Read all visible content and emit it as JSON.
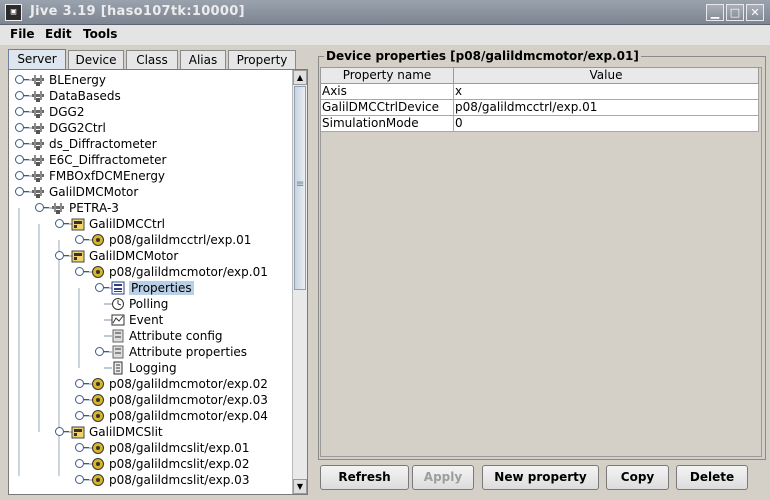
{
  "window": {
    "title": "Jive 3.19  [haso107tk:10000]",
    "app_icon_text": "▣",
    "min_glyph": "▁",
    "max_glyph": "□",
    "close_glyph": "✕"
  },
  "menu": {
    "file": "File",
    "edit": "Edit",
    "tools": "Tools"
  },
  "tabs": [
    {
      "label": "Server",
      "active": true
    },
    {
      "label": "Device",
      "active": false
    },
    {
      "label": "Class",
      "active": false
    },
    {
      "label": "Alias",
      "active": false
    },
    {
      "label": "Property",
      "active": false
    }
  ],
  "tree": [
    {
      "label": "BLEnergy",
      "icon": "server-icon"
    },
    {
      "label": "DataBaseds",
      "icon": "server-icon"
    },
    {
      "label": "DGG2",
      "icon": "server-icon"
    },
    {
      "label": "DGG2Ctrl",
      "icon": "server-icon"
    },
    {
      "label": "ds_Diffractometer",
      "icon": "server-icon"
    },
    {
      "label": "E6C_Diffractometer",
      "icon": "server-icon"
    },
    {
      "label": "FMBOxfDCMEnergy",
      "icon": "server-icon"
    },
    {
      "label": "GalilDMCMotor",
      "icon": "server-icon"
    },
    {
      "label": "PETRA-3",
      "icon": "server-icon"
    },
    {
      "label": "GalilDMCCtrl",
      "icon": "class-icon"
    },
    {
      "label": "p08/galildmcctrl/exp.01",
      "icon": "device-icon"
    },
    {
      "label": "GalilDMCMotor",
      "icon": "class-icon"
    },
    {
      "label": "p08/galildmcmotor/exp.01",
      "icon": "device-icon"
    },
    {
      "label": "Properties",
      "icon": "properties-icon",
      "selected": true
    },
    {
      "label": "Polling",
      "icon": "polling-icon"
    },
    {
      "label": "Event",
      "icon": "event-icon"
    },
    {
      "label": "Attribute config",
      "icon": "attribute-config-icon"
    },
    {
      "label": "Attribute properties",
      "icon": "attribute-properties-icon"
    },
    {
      "label": "Logging",
      "icon": "logging-icon"
    },
    {
      "label": "p08/galildmcmotor/exp.02",
      "icon": "device-icon"
    },
    {
      "label": "p08/galildmcmotor/exp.03",
      "icon": "device-icon"
    },
    {
      "label": "p08/galildmcmotor/exp.04",
      "icon": "device-icon"
    },
    {
      "label": "GalilDMCSlit",
      "icon": "class-icon"
    },
    {
      "label": "p08/galildmcslit/exp.01",
      "icon": "device-icon"
    },
    {
      "label": "p08/galildmcslit/exp.02",
      "icon": "device-icon"
    },
    {
      "label": "p08/galildmcslit/exp.03",
      "icon": "device-icon"
    }
  ],
  "panel": {
    "title": "Device properties [p08/galildmcmotor/exp.01]",
    "columns": [
      "Property name",
      "Value"
    ],
    "rows": [
      {
        "name": "Axis",
        "value": "x"
      },
      {
        "name": "GalilDMCCtrlDevice",
        "value": "p08/galildmcctrl/exp.01"
      },
      {
        "name": "SimulationMode",
        "value": "0"
      }
    ]
  },
  "buttons": {
    "refresh": "Refresh",
    "apply": "Apply",
    "new_property": "New property",
    "copy": "Copy",
    "delete": "Delete"
  },
  "scroll": {
    "up_glyph": "▲",
    "down_glyph": "▼"
  },
  "colors": {
    "selection": "#b8cfe5",
    "active_tab": "#dde5ee"
  }
}
